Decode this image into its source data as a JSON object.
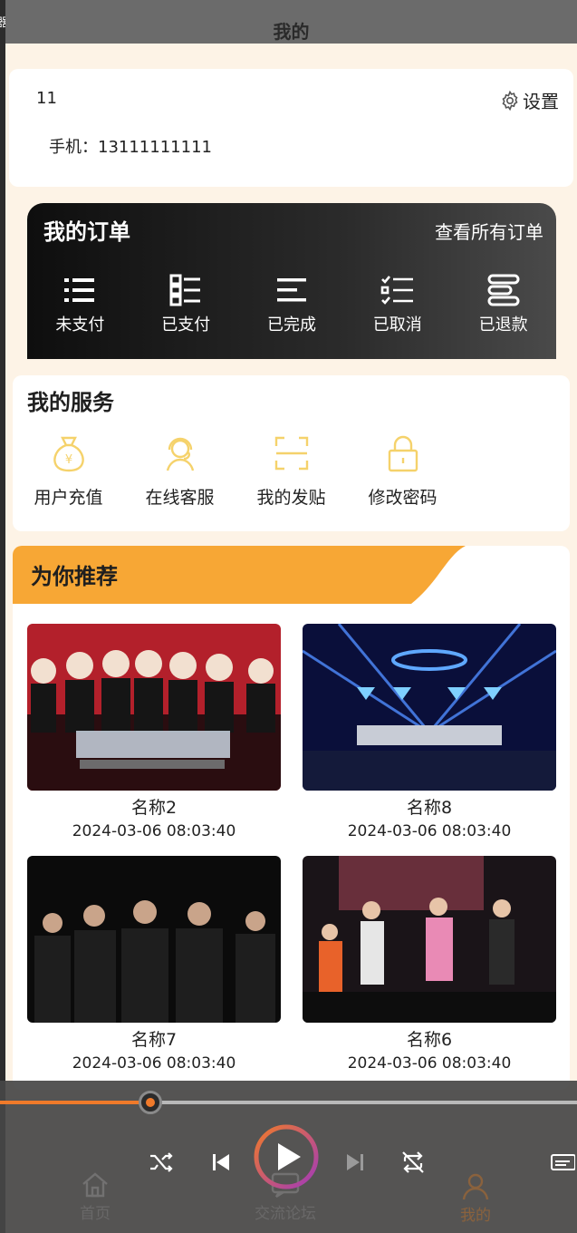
{
  "left_strip": {
    "glyph": "器"
  },
  "header": {
    "title": "我的"
  },
  "user": {
    "name": "11",
    "phone": "手机：13111111111",
    "settings_label": "设置"
  },
  "orders": {
    "title": "我的订单",
    "view_all": "查看所有订单",
    "items": [
      {
        "label": "未支付",
        "icon": "list-bullets-icon"
      },
      {
        "label": "已支付",
        "icon": "grid-list-icon"
      },
      {
        "label": "已完成",
        "icon": "lines-icon"
      },
      {
        "label": "已取消",
        "icon": "checklist-icon"
      },
      {
        "label": "已退款",
        "icon": "stack-icon"
      }
    ]
  },
  "services": {
    "title": "我的服务",
    "items": [
      {
        "label": "用户充值",
        "icon": "money-bag-icon"
      },
      {
        "label": "在线客服",
        "icon": "support-agent-icon"
      },
      {
        "label": "我的发贴",
        "icon": "scan-frame-icon"
      },
      {
        "label": "修改密码",
        "icon": "lock-icon"
      }
    ],
    "icon_color": "#f5d26b"
  },
  "recommend": {
    "title": "为你推荐",
    "accent": "#f7a735",
    "items": [
      {
        "name": "名称2",
        "date": "2024-03-06 08:03:40"
      },
      {
        "name": "名称8",
        "date": "2024-03-06 08:03:40"
      },
      {
        "name": "名称7",
        "date": "2024-03-06 08:03:40"
      },
      {
        "name": "名称6",
        "date": "2024-03-06 08:03:40"
      }
    ]
  },
  "player": {
    "progress_fraction": 0.26,
    "accent": "#f07a2a"
  },
  "tabs": [
    {
      "label": "首页",
      "icon": "home-icon"
    },
    {
      "label": "交流论坛",
      "icon": "forum-icon"
    },
    {
      "label": "我的",
      "icon": "user-icon",
      "active": true
    }
  ]
}
